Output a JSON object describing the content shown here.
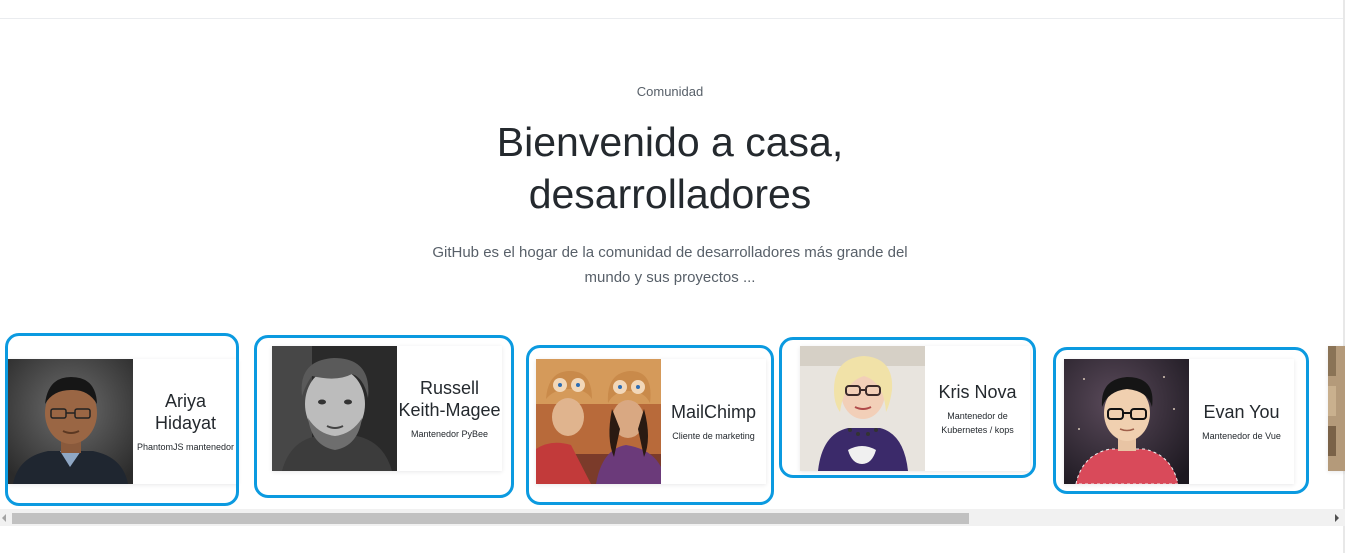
{
  "section": {
    "eyebrow": "Comunidad",
    "title": "Bienvenido a casa, desarrolladores",
    "lead": "GitHub es el hogar de la comunidad de desarrolladores más grande del mundo y sus proyectos ..."
  },
  "cards": [
    {
      "name": "Ariya Hidayat",
      "role": "PhantomJS mantenedor"
    },
    {
      "name": "Russell Keith-Magee",
      "role": "Mantenedor PyBee"
    },
    {
      "name": "MailChimp",
      "role": "Cliente de marketing"
    },
    {
      "name": "Kris Nova",
      "role": "Mantenedor de Kubernetes / kops"
    },
    {
      "name": "Evan You",
      "role": "Mantenedor de Vue"
    }
  ],
  "colors": {
    "highlight_ring": "#0b9ae0",
    "heading": "#24292e",
    "muted": "#586069"
  }
}
